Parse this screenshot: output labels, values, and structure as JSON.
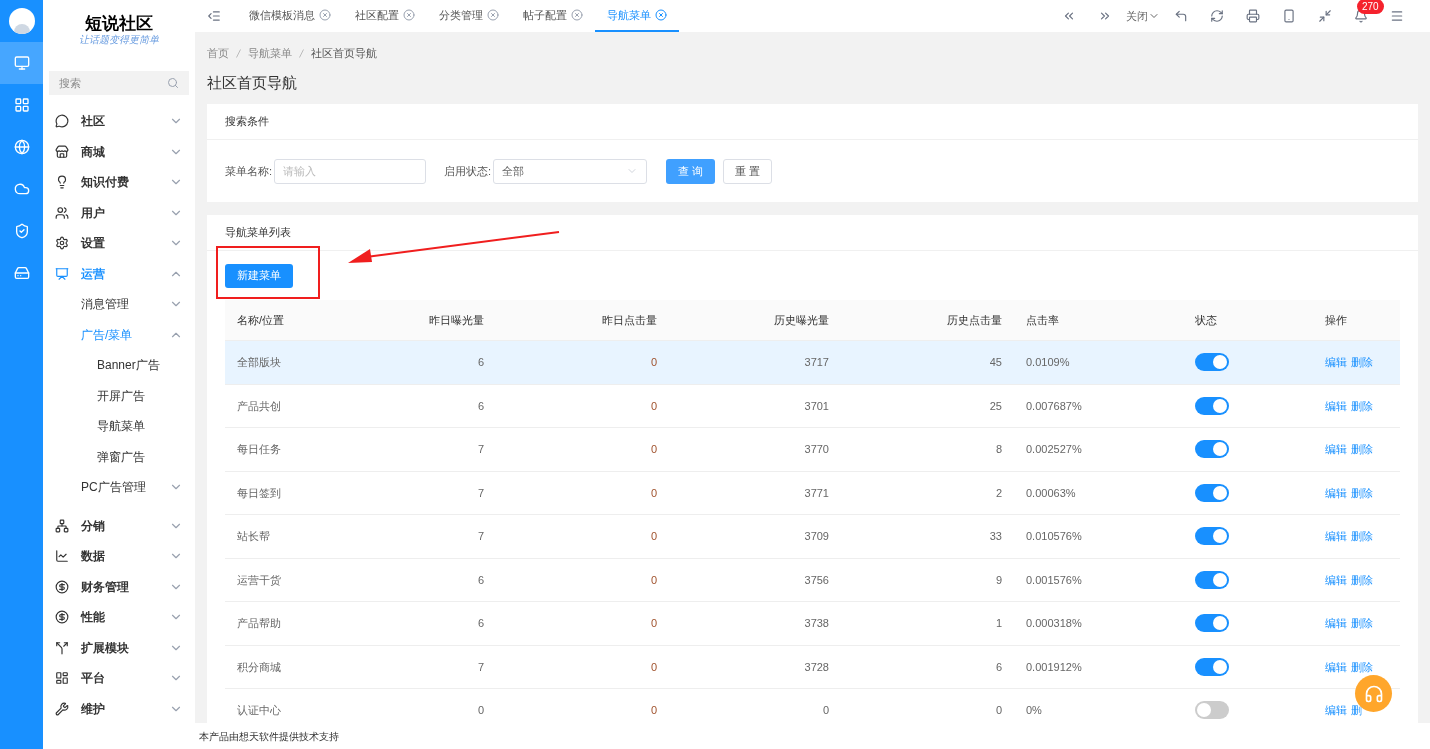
{
  "logo": {
    "title": "短说社区",
    "slogan": "让话题变得更简单"
  },
  "rail": [
    {
      "selected": true
    },
    {
      "selected": false
    },
    {
      "selected": false
    },
    {
      "selected": false
    },
    {
      "selected": false
    },
    {
      "selected": false
    }
  ],
  "sidebar": {
    "search": {
      "placeholder": "搜索"
    },
    "items": [
      {
        "label": "社区",
        "expanded": false,
        "selected": false
      },
      {
        "label": "商城",
        "expanded": false,
        "selected": false
      },
      {
        "label": "知识付费",
        "expanded": false,
        "selected": false
      },
      {
        "label": "用户",
        "expanded": false,
        "selected": false
      },
      {
        "label": "设置",
        "expanded": false,
        "selected": false
      },
      {
        "label": "运营",
        "expanded": true,
        "selected": true,
        "children": [
          {
            "label": "消息管理",
            "expanded": false,
            "selected": false
          },
          {
            "label": "广告/菜单",
            "expanded": true,
            "selected": true,
            "children": [
              {
                "label": "Banner广告",
                "selected": false
              },
              {
                "label": "开屏广告",
                "selected": false
              },
              {
                "label": "导航菜单",
                "selected": false
              },
              {
                "label": "弹窗广告",
                "selected": false
              }
            ]
          },
          {
            "label": "PC广告管理",
            "expanded": false,
            "selected": false
          }
        ]
      },
      {
        "label": "分销",
        "expanded": false,
        "selected": false
      },
      {
        "label": "数据",
        "expanded": false,
        "selected": false
      },
      {
        "label": "财务管理",
        "expanded": false,
        "selected": false
      },
      {
        "label": "性能",
        "expanded": false,
        "selected": false
      },
      {
        "label": "扩展模块",
        "expanded": false,
        "selected": false
      },
      {
        "label": "平台",
        "expanded": false,
        "selected": false
      },
      {
        "label": "维护",
        "expanded": false,
        "selected": false
      }
    ]
  },
  "tabs": [
    {
      "label": "微信模板消息",
      "selected": false
    },
    {
      "label": "社区配置",
      "selected": false
    },
    {
      "label": "分类管理",
      "selected": false
    },
    {
      "label": "帖子配置",
      "selected": false
    },
    {
      "label": "导航菜单",
      "selected": true
    }
  ],
  "toolbar": {
    "close_menu": "关闭",
    "notifications": "270"
  },
  "breadcrumb": [
    "首页",
    "导航菜单",
    "社区首页导航"
  ],
  "page_title": "社区首页导航",
  "search_card": {
    "title": "搜索条件",
    "name_label": "菜单名称:",
    "name_placeholder": "请输入",
    "status_label": "启用状态:",
    "status_value": "全部",
    "query_button": "查 询",
    "reset_button": "重 置"
  },
  "list_card": {
    "title": "导航菜单列表",
    "new_button": "新建菜单"
  },
  "table": {
    "columns": [
      "名称/位置",
      "昨日曝光量",
      "昨日点击量",
      "历史曝光量",
      "历史点击量",
      "点击率",
      "状态",
      "操作"
    ],
    "rows": [
      {
        "cells": [
          "全部版块",
          "6",
          "0",
          "3717",
          "45",
          "0.0109%"
        ],
        "on": true,
        "selected": true,
        "actions": [
          "编辑",
          "删除"
        ]
      },
      {
        "cells": [
          "产品共创",
          "6",
          "0",
          "3701",
          "25",
          "0.007687%"
        ],
        "on": true,
        "selected": false,
        "actions": [
          "编辑",
          "删除"
        ]
      },
      {
        "cells": [
          "每日任务",
          "7",
          "0",
          "3770",
          "8",
          "0.002527%"
        ],
        "on": true,
        "selected": false,
        "actions": [
          "编辑",
          "删除"
        ]
      },
      {
        "cells": [
          "每日签到",
          "7",
          "0",
          "3771",
          "2",
          "0.00063%"
        ],
        "on": true,
        "selected": false,
        "actions": [
          "编辑",
          "删除"
        ]
      },
      {
        "cells": [
          "站长帮",
          "7",
          "0",
          "3709",
          "33",
          "0.010576%"
        ],
        "on": true,
        "selected": false,
        "actions": [
          "编辑",
          "删除"
        ]
      },
      {
        "cells": [
          "运营干货",
          "6",
          "0",
          "3756",
          "9",
          "0.001576%"
        ],
        "on": true,
        "selected": false,
        "actions": [
          "编辑",
          "删除"
        ]
      },
      {
        "cells": [
          "产品帮助",
          "6",
          "0",
          "3738",
          "1",
          "0.000318%"
        ],
        "on": true,
        "selected": false,
        "actions": [
          "编辑",
          "删除"
        ]
      },
      {
        "cells": [
          "积分商城",
          "7",
          "0",
          "3728",
          "6",
          "0.001912%"
        ],
        "on": true,
        "selected": false,
        "actions": [
          "编辑",
          "删除"
        ]
      },
      {
        "cells": [
          "认证中心",
          "0",
          "0",
          "0",
          "0",
          "0%"
        ],
        "on": false,
        "selected": false,
        "actions": [
          "编辑",
          "删"
        ]
      }
    ]
  },
  "footer": "本产品由想天软件提供技术支持"
}
